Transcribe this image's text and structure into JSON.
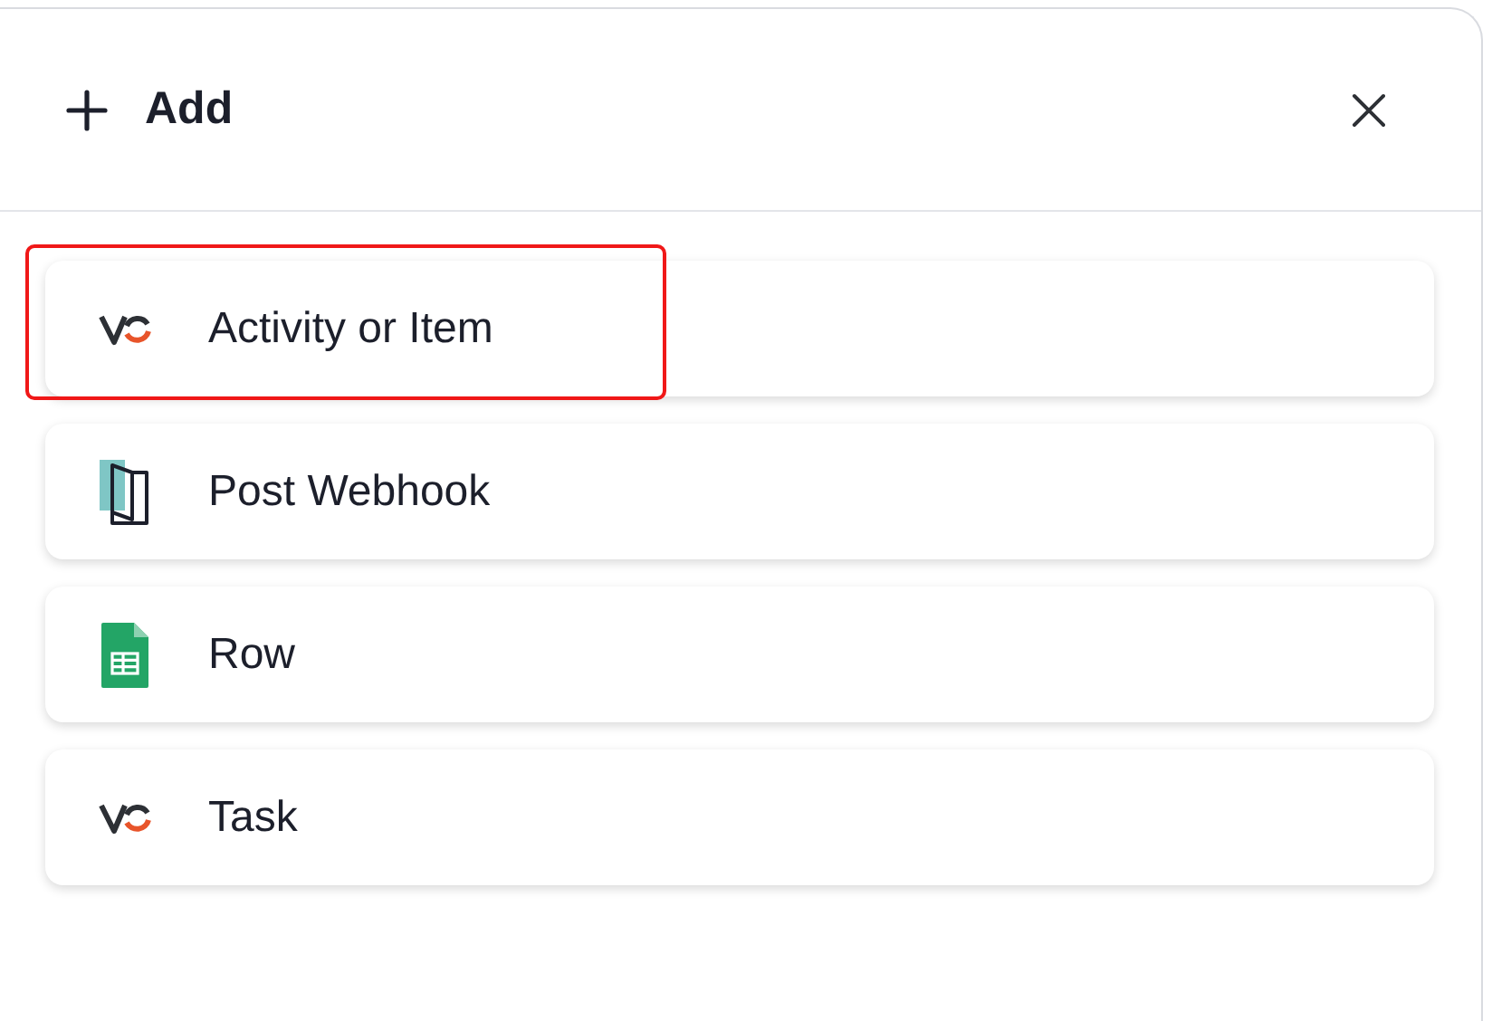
{
  "header": {
    "title": "Add"
  },
  "items": [
    {
      "label": "Activity or Item",
      "kind": "vo",
      "selected": true
    },
    {
      "label": "Post Webhook",
      "kind": "webhook",
      "selected": false
    },
    {
      "label": "Row",
      "kind": "sheet",
      "selected": false
    },
    {
      "label": "Task",
      "kind": "vo",
      "selected": false
    }
  ]
}
